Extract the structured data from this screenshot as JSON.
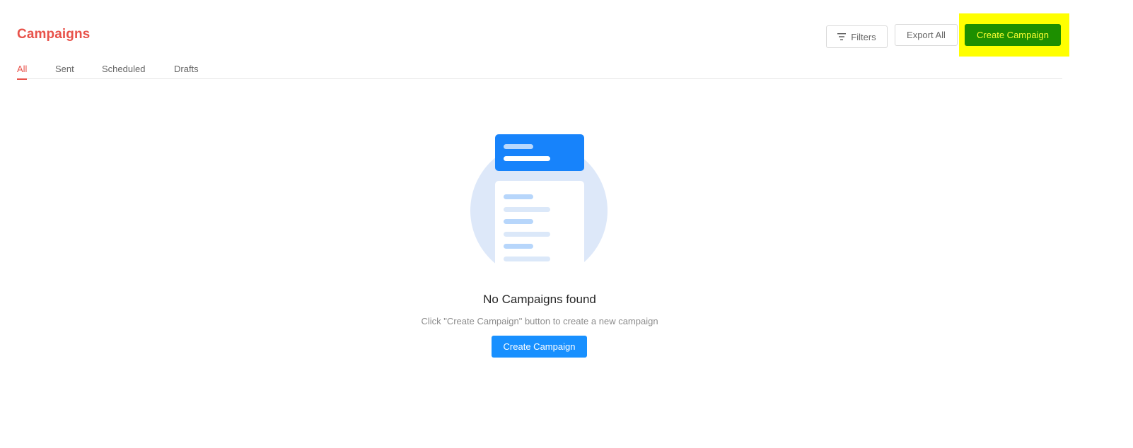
{
  "header": {
    "title": "Campaigns",
    "filters_label": "Filters",
    "export_label": "Export All",
    "create_label": "Create Campaign"
  },
  "tabs": [
    {
      "label": "All",
      "active": true
    },
    {
      "label": "Sent",
      "active": false
    },
    {
      "label": "Scheduled",
      "active": false
    },
    {
      "label": "Drafts",
      "active": false
    }
  ],
  "empty_state": {
    "title": "No Campaigns found",
    "description": "Click \"Create Campaign\" button to create a new campaign",
    "button_label": "Create Campaign",
    "illustration_icon": "campaign-document-illustration"
  },
  "icons": {
    "filters": "filter-icon"
  },
  "colors": {
    "brand": "#e8524a",
    "primary": "#1890ff",
    "create_button_bg": "#1d8f00",
    "create_button_text": "#ffff33",
    "highlight": "#ffff00"
  }
}
